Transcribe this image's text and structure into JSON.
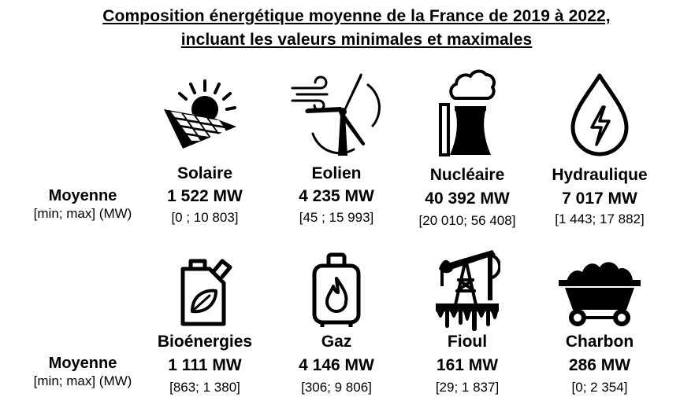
{
  "title": {
    "line1": "Composition énergétique moyenne de la France de 2019 à 2022,",
    "line2": "incluant les valeurs minimales et maximales"
  },
  "row_label": {
    "moyenne": "Moyenne",
    "range": "[min; max] (MW)"
  },
  "row1": [
    {
      "name": "Solaire",
      "avg": "1 522 MW",
      "range": "[0 ; 10 803]",
      "icon": "solar-panel-icon"
    },
    {
      "name": "Eolien",
      "avg": "4 235 MW",
      "range": "[45 ; 15 993]",
      "icon": "wind-turbine-icon"
    },
    {
      "name": "Nucléaire",
      "avg": "40 392 MW",
      "range": "[20 010; 56 408]",
      "icon": "nuclear-plant-icon"
    },
    {
      "name": "Hydraulique",
      "avg": "7 017 MW",
      "range": "[1 443; 17 882]",
      "icon": "water-drop-icon"
    }
  ],
  "row2": [
    {
      "name": "Bioénergies",
      "avg": "1 111 MW",
      "range": "[863; 1 380]",
      "icon": "bio-fuel-can-icon"
    },
    {
      "name": "Gaz",
      "avg": "4 146 MW",
      "range": "[306;  9 806]",
      "icon": "gas-cylinder-icon"
    },
    {
      "name": "Fioul",
      "avg": "161 MW",
      "range": "[29; 1 837]",
      "icon": "oil-pump-icon"
    },
    {
      "name": "Charbon",
      "avg": "286 MW",
      "range": "[0; 2 354]",
      "icon": "coal-cart-icon"
    }
  ]
}
